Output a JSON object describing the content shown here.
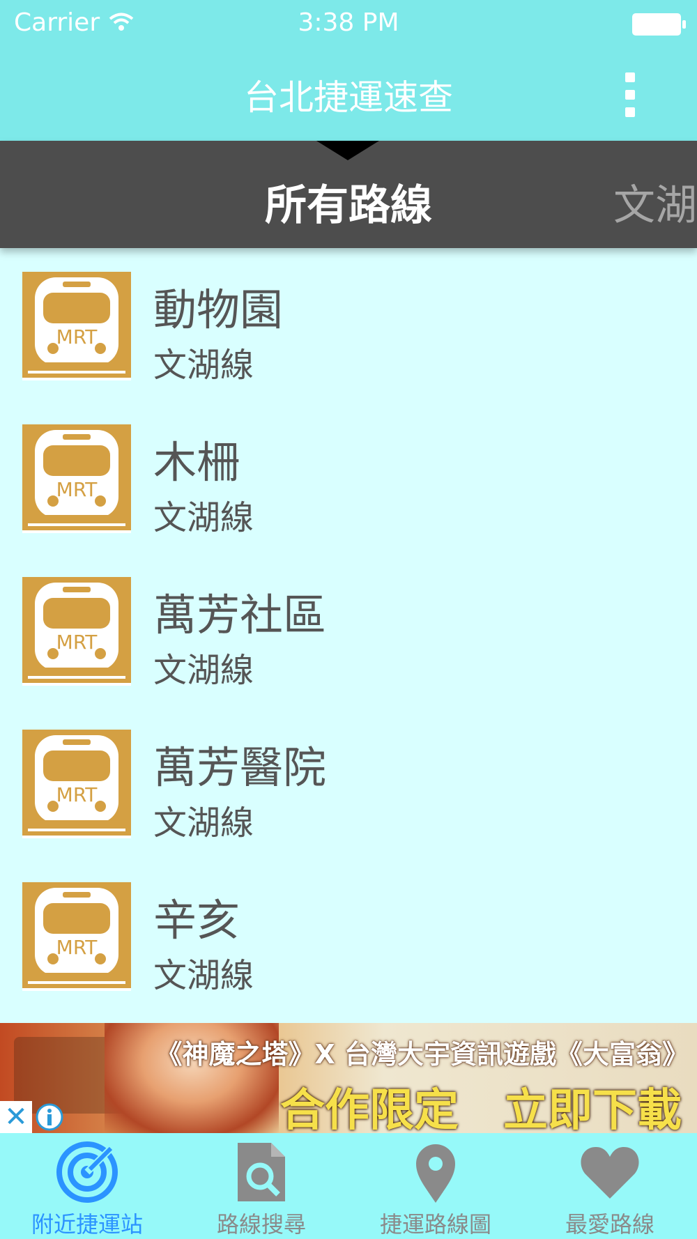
{
  "status_bar": {
    "carrier": "Carrier",
    "time": "3:38 PM",
    "wifi_icon": "wifi-icon",
    "battery_icon": "battery-icon"
  },
  "nav": {
    "title": "台北捷運速查",
    "menu_icon": "more-vertical-icon"
  },
  "line_tabs": {
    "current": "所有路線",
    "next": "文湖線"
  },
  "stations": [
    {
      "name": "動物園",
      "line": "文湖線",
      "icon": "mrt-train-icon"
    },
    {
      "name": "木柵",
      "line": "文湖線",
      "icon": "mrt-train-icon"
    },
    {
      "name": "萬芳社區",
      "line": "文湖線",
      "icon": "mrt-train-icon"
    },
    {
      "name": "萬芳醫院",
      "line": "文湖線",
      "icon": "mrt-train-icon"
    },
    {
      "name": "辛亥",
      "line": "文湖線",
      "icon": "mrt-train-icon"
    }
  ],
  "icon_text": "MRT",
  "ad": {
    "headline": "《神魔之塔》X 台灣大宇資訊遊戲《大富翁》",
    "cta": "合作限定　立即下載",
    "close_symbol": "✕"
  },
  "tabs": [
    {
      "label": "附近捷運站",
      "icon": "nearby-radar-icon",
      "active": true
    },
    {
      "label": "路線搜尋",
      "icon": "search-document-icon",
      "active": false
    },
    {
      "label": "捷運路線圖",
      "icon": "map-pin-icon",
      "active": false
    },
    {
      "label": "最愛路線",
      "icon": "heart-icon",
      "active": false
    }
  ],
  "colors": {
    "header": "#7de9e9",
    "tab_strip": "#4d4d4d",
    "list_background": "#d9ffff",
    "icon_gold": "#d4a043",
    "tab_bar": "#96f9f9",
    "active_tab": "#2b93ff",
    "inactive_tab": "#8a8a8a"
  }
}
